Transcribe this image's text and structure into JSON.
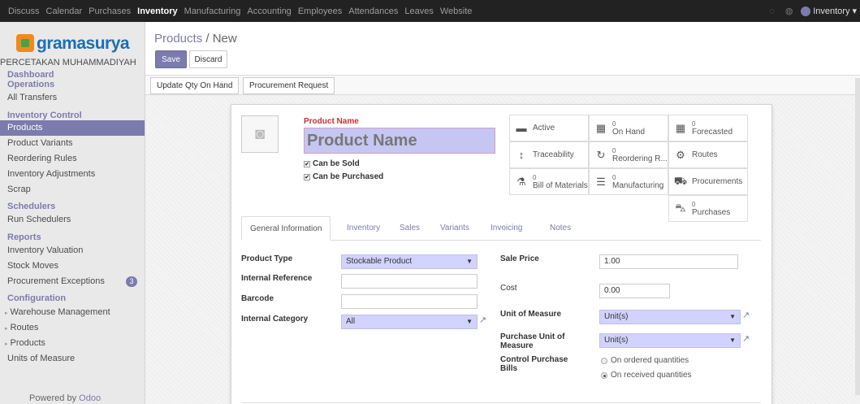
{
  "topbar": {
    "menu": [
      "Discuss",
      "Calendar",
      "Purchases",
      "Inventory",
      "Manufacturing",
      "Accounting",
      "Employees",
      "Attendances",
      "Leaves",
      "Website"
    ],
    "active": "Inventory",
    "user": "Inventory"
  },
  "sidebar": {
    "logo_text": "gramasurya",
    "logo_sub": "PERCETAKAN MUHAMMADIYAH",
    "items": [
      {
        "type": "section",
        "label": "Dashboard"
      },
      {
        "type": "section",
        "label": "Operations"
      },
      {
        "type": "item",
        "label": "All Transfers"
      },
      {
        "type": "section",
        "label": "Inventory Control"
      },
      {
        "type": "item",
        "label": "Products",
        "active": true
      },
      {
        "type": "item",
        "label": "Product Variants"
      },
      {
        "type": "item",
        "label": "Reordering Rules"
      },
      {
        "type": "item",
        "label": "Inventory Adjustments"
      },
      {
        "type": "item",
        "label": "Scrap"
      },
      {
        "type": "section",
        "label": "Schedulers"
      },
      {
        "type": "item",
        "label": "Run Schedulers"
      },
      {
        "type": "section",
        "label": "Reports"
      },
      {
        "type": "item",
        "label": "Inventory Valuation"
      },
      {
        "type": "item",
        "label": "Stock Moves"
      },
      {
        "type": "item",
        "label": "Procurement Exceptions",
        "badge": "3"
      },
      {
        "type": "section",
        "label": "Configuration"
      },
      {
        "type": "item",
        "label": "Warehouse Management",
        "caret": true
      },
      {
        "type": "item",
        "label": "Routes",
        "caret": true
      },
      {
        "type": "item",
        "label": "Products",
        "caret": true
      },
      {
        "type": "item",
        "label": "Units of Measure"
      }
    ],
    "powered_prefix": "Powered by",
    "powered_brand": "Odoo"
  },
  "control_panel": {
    "breadcrumb_parent": "Products",
    "breadcrumb_sep": " / ",
    "breadcrumb_current": "New",
    "save_label": "Save",
    "discard_label": "Discard"
  },
  "statusbar": {
    "update_qty_label": "Update Qty On Hand",
    "procurement_label": "Procurement Request"
  },
  "form": {
    "product_name_label": "Product Name",
    "product_name_placeholder": "Product Name",
    "can_be_sold": "Can be Sold",
    "can_be_purchased": "Can be Purchased",
    "smart_buttons": [
      {
        "icon": "archive-icon",
        "glyph": "▬",
        "label": "Active"
      },
      {
        "icon": "on-hand-icon",
        "glyph": "▦",
        "count": "0",
        "label": "On Hand"
      },
      {
        "icon": "forecasted-icon",
        "glyph": "▦",
        "count": "0",
        "label": "Forecasted"
      },
      {
        "icon": "traceability-icon",
        "glyph": "↕",
        "label": "Traceability"
      },
      {
        "icon": "refresh-icon",
        "glyph": "↻",
        "count": "0",
        "label": "Reordering R..."
      },
      {
        "icon": "cogs-icon",
        "glyph": "⚙",
        "label": "Routes"
      },
      {
        "icon": "flask-icon",
        "glyph": "⚗",
        "count": "0",
        "label": "Bill of Materials"
      },
      {
        "icon": "list-icon",
        "glyph": "☰",
        "count": "0",
        "label": "Manufacturing"
      },
      {
        "icon": "truck-icon",
        "glyph": "⛟",
        "label": "Procurements"
      },
      {
        "icon": "cart-icon",
        "glyph": "⛍",
        "count": "0",
        "label": "Purchases"
      }
    ],
    "tabs": [
      "General Information",
      "Inventory",
      "Sales",
      "Variants",
      "Invoicing",
      "Notes"
    ],
    "active_tab": "General Information",
    "product_type_label": "Product Type",
    "product_type_value": "Stockable Product",
    "internal_reference_label": "Internal Reference",
    "internal_reference_value": "",
    "barcode_label": "Barcode",
    "barcode_value": "",
    "internal_category_label": "Internal Category",
    "internal_category_value": "All",
    "sale_price_label": "Sale Price",
    "sale_price_value": "1.00",
    "cost_label": "Cost",
    "cost_value": "0.00",
    "uom_label": "Unit of Measure",
    "uom_value": "Unit(s)",
    "purchase_uom_label": "Purchase Unit of Measure",
    "purchase_uom_value": "Unit(s)",
    "control_bills_label": "Control Purchase Bills",
    "control_options": [
      "On ordered quantities",
      "On received quantities"
    ],
    "control_selected": "On received quantities"
  }
}
